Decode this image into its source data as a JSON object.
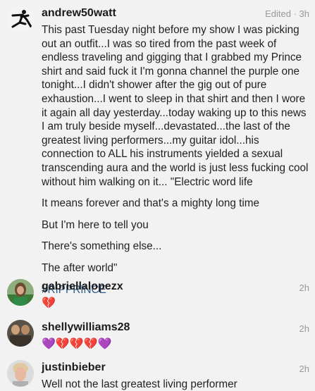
{
  "post": {
    "username": "andrew50watt",
    "edited": "Edited",
    "time": "3h",
    "caption": [
      "This past Tuesday night before my show I was picking out an outfit...I was so tired from the past week of endless traveling and gigging that I grabbed my Prince shirt and said fuck it I'm gonna channel the purple one tonight...I didn't shower after the gig out of pure exhaustion...I went to sleep in that shirt and then I wore it again all day yesterday...today waking up to this news I am truly beside myself...devastated...the last of the greatest living performers...my guitar idol...his connection to ALL his instruments yielded a sexual transcending aura and the world is just less fucking cool without him walking on it... \"Electric word life",
      "It means forever and that's a mighty long time",
      "But I'm here to tell you",
      "There's something else...",
      "The after world\""
    ],
    "hashtag": "#RIPPRINCE"
  },
  "comments": [
    {
      "username": "gabriellalopezx",
      "time": "2h",
      "text": "💔"
    },
    {
      "username": "shellywilliams28",
      "time": "2h",
      "text": "💜💔💔💔💜"
    },
    {
      "username": "justinbieber",
      "time": "2h",
      "text": "Well not the last greatest living performer"
    }
  ]
}
